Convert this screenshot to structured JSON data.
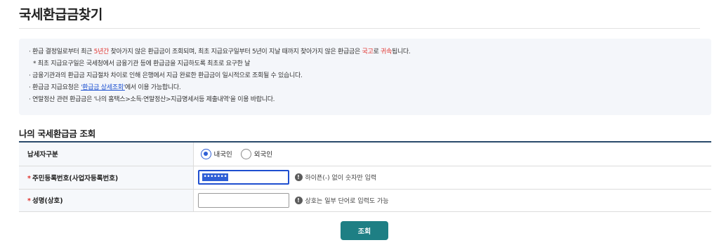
{
  "page": {
    "title": "국세환급금찾기"
  },
  "info": {
    "line1": {
      "a": "· 환급 결정일로부터 최근 ",
      "b": "5년간",
      "c": " 찾아가지 않은 환급금이 조회되며, 최초 지급요구일부터 5년이 지날 때까지 찾아가지 않은 환급금은 ",
      "d": "국고",
      "e": "로 ",
      "f": "귀속",
      "g": "됩니다."
    },
    "line2": "* 최초 지급요구일은 국세청에서 금융기관 등에 환급금을 지급하도록 최초로 요구한 날",
    "line3": "· 금융기관과의 환급금 지급절차 차이로 인해 은행에서 지급 완료한 환급금이 일시적으로 조회될 수 있습니다.",
    "line4": {
      "a": "· 환급금 지급요청은 ",
      "link": "'환급금 상세조회'",
      "b": "에서 이용 가능합니다."
    },
    "line5": "· 연말정산 관련 환급금은 '나의 홈택스>소득·연말정산>지급명세서등 제출내역'을 이용 바랍니다."
  },
  "section": {
    "title": "나의 국세환급금 조회"
  },
  "form": {
    "taxpayer_type": {
      "label": "납세자구분",
      "options": [
        "내국인",
        "외국인"
      ],
      "selected": "내국인"
    },
    "resident_no": {
      "required_mark": "*",
      "label": "주민등록번호(사업자등록번호)",
      "value": "•••••••",
      "hint": "하이픈(-) 없이 숫자만 입력"
    },
    "name": {
      "required_mark": "*",
      "label": "성명(상호)",
      "value": "",
      "hint": "상호는 일부 단어로 입력도 가능"
    }
  },
  "submit": {
    "label": "조회"
  },
  "colors": {
    "accent": "#1e7f84",
    "required": "#e0332e",
    "header_rule": "#2a4a6b",
    "info_bg": "#f4f6fa"
  }
}
